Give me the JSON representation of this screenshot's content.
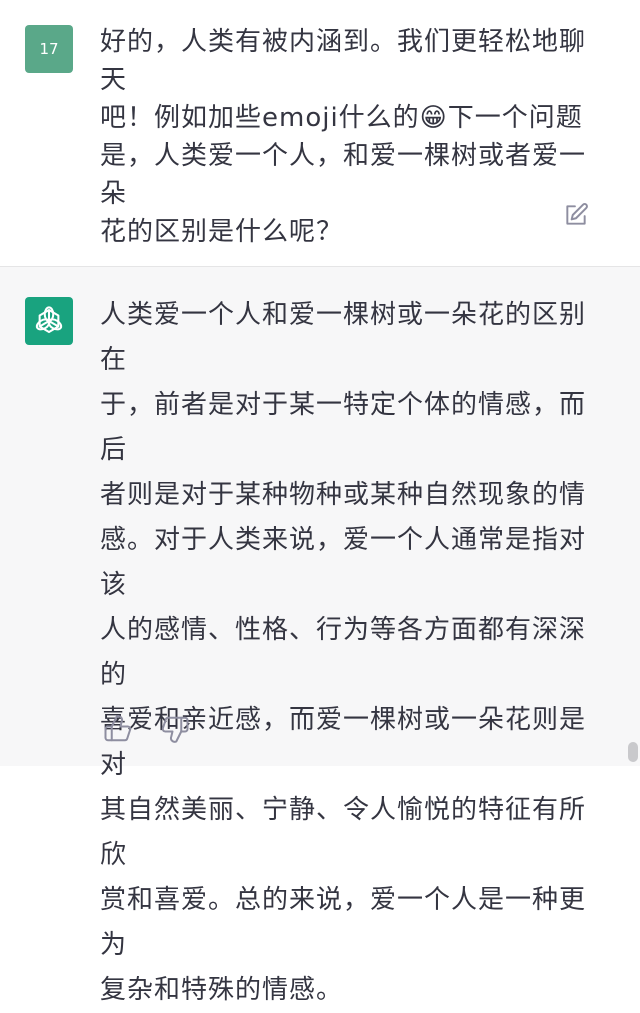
{
  "user_message": {
    "avatar_label": "17",
    "text": "好的，人类有被内涵到。我们更轻松地聊天\n吧！例如加些emoji什么的😁下一个问题\n是，人类爱一个人，和爱一棵树或者爱一朵\n花的区别是什么呢？"
  },
  "assistant_message": {
    "avatar_icon": "openai-logo-icon",
    "text": "人类爱一个人和爱一棵树或一朵花的区别在\n于，前者是对于某一特定个体的情感，而后\n者则是对于某种物种或某种自然现象的情\n感。对于人类来说，爱一个人通常是指对该\n人的感情、性格、行为等各方面都有深深的\n喜爱和亲近感，而爱一棵树或一朵花则是对\n其自然美丽、宁静、令人愉悦的特征有所欣\n赏和喜爱。总的来说，爱一个人是一种更为\n复杂和特殊的情感。"
  },
  "actions": {
    "edit_icon": "edit-icon",
    "thumbs_up_icon": "thumbs-up-icon",
    "thumbs_down_icon": "thumbs-down-icon"
  },
  "colors": {
    "user_avatar": "#5aa889",
    "assistant_avatar": "#19a37f",
    "assistant_bg": "#f7f7f8",
    "text": "#343541"
  }
}
